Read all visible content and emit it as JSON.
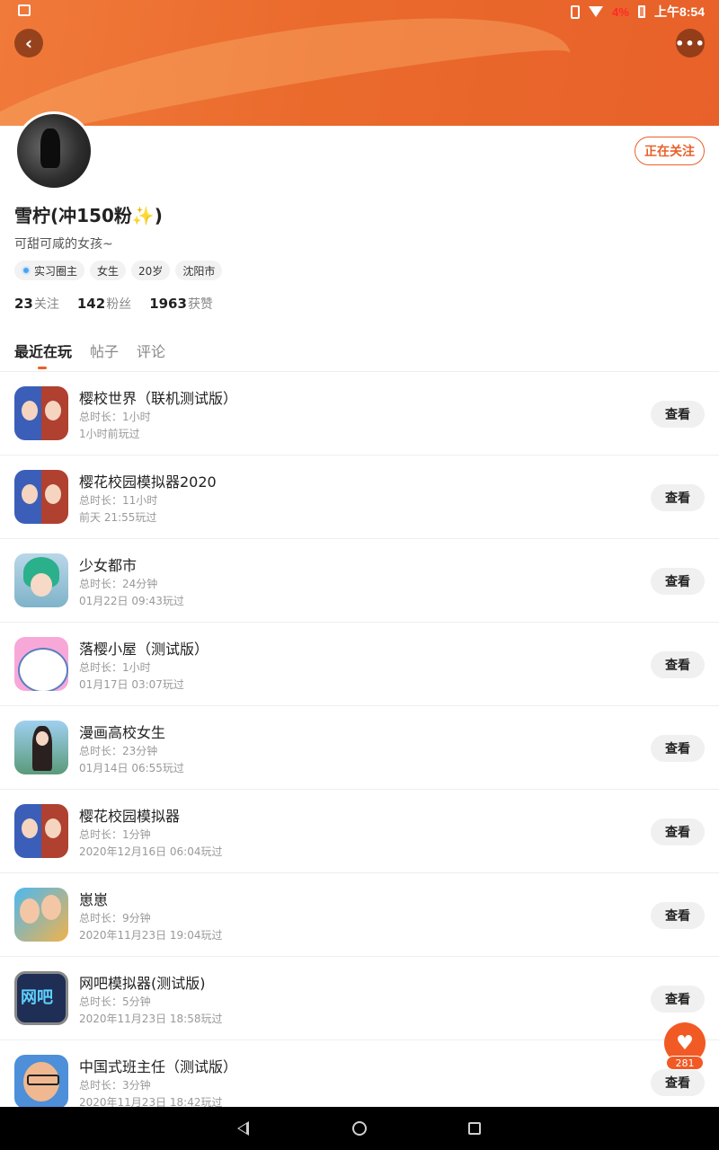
{
  "status_bar": {
    "battery_percent": "4%",
    "time": "上午8:54"
  },
  "profile": {
    "name": "雪柠(冲150粉",
    "name_sparkle": "✨",
    "name_close": ")",
    "bio": "可甜可咸的女孩~",
    "follow_label": "正在关注",
    "tags": [
      "实习圈主",
      "女生",
      "20岁",
      "沈阳市"
    ],
    "stats": [
      {
        "count": "23",
        "label": "关注"
      },
      {
        "count": "142",
        "label": "粉丝"
      },
      {
        "count": "1963",
        "label": "获赞"
      }
    ]
  },
  "tabs": [
    "最近在玩",
    "帖子",
    "评论"
  ],
  "games": [
    {
      "name": "樱校世界（联机测试版）",
      "duration": "总时长：1小时",
      "last_played": "1小时前玩过",
      "icon": "anime-duo-icon"
    },
    {
      "name": "樱花校园模拟器2020",
      "duration": "总时长：11小时",
      "last_played": "前天 21:55玩过",
      "icon": "anime-duo-icon"
    },
    {
      "name": "少女都市",
      "duration": "总时长：24分钟",
      "last_played": "01月22日 09:43玩过",
      "icon": "green-hair-girl-icon"
    },
    {
      "name": "落樱小屋（测试版）",
      "duration": "总时长：1小时",
      "last_played": "01月17日 03:07玩过",
      "icon": "cartoon-face-icon"
    },
    {
      "name": "漫画高校女生",
      "duration": "总时长：23分钟",
      "last_played": "01月14日 06:55玩过",
      "icon": "school-girl-icon"
    },
    {
      "name": "樱花校园模拟器",
      "duration": "总时长：1分钟",
      "last_played": "2020年12月16日 06:04玩过",
      "icon": "anime-duo-icon"
    },
    {
      "name": "崽崽",
      "duration": "总时长：9分钟",
      "last_played": "2020年11月23日 19:04玩过",
      "icon": "two-girls-icon"
    },
    {
      "name": "网吧模拟器(测试版)",
      "duration": "总时长：5分钟",
      "last_played": "2020年11月23日 18:58玩过",
      "icon": "netbar-icon",
      "icon_text": "网吧"
    },
    {
      "name": "中国式班主任（测试版）",
      "duration": "总时长：3分钟",
      "last_played": "2020年11月23日 18:42玩过",
      "icon": "teacher-icon"
    }
  ],
  "view_label": "查看",
  "like_count": "281",
  "colors": {
    "accent": "#e8612a",
    "banner": "#ea6a2c",
    "like": "#f15a24"
  }
}
